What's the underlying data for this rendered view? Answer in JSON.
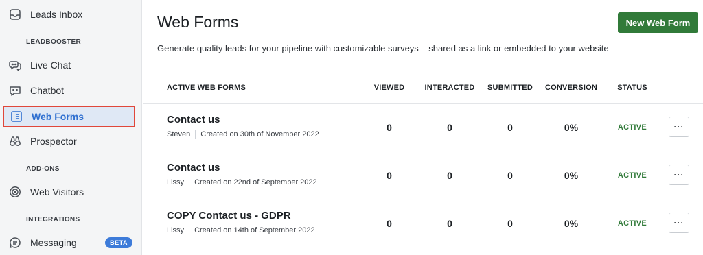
{
  "sidebar": {
    "items": [
      {
        "label": "Leads Inbox",
        "icon": "inbox-icon"
      },
      {
        "label": "Live Chat",
        "icon": "chat-bubbles-icon"
      },
      {
        "label": "Chatbot",
        "icon": "bot-icon"
      },
      {
        "label": "Web Forms",
        "icon": "list-form-icon"
      },
      {
        "label": "Prospector",
        "icon": "binoculars-icon"
      },
      {
        "label": "Web Visitors",
        "icon": "radar-icon"
      },
      {
        "label": "Messaging",
        "icon": "message-icon",
        "badge": "BETA"
      }
    ],
    "sections": {
      "leadbooster": "LEADBOOSTER",
      "addons": "ADD-ONS",
      "integrations": "INTEGRATIONS"
    },
    "active_item": "Web Forms"
  },
  "header": {
    "title": "Web Forms",
    "new_button": "New Web Form",
    "subtitle": "Generate quality leads for your pipeline with customizable surveys – shared as a link or embedded to your website"
  },
  "table": {
    "columns": [
      "ACTIVE WEB FORMS",
      "VIEWED",
      "INTERACTED",
      "SUBMITTED",
      "CONVERSION",
      "STATUS"
    ],
    "rows": [
      {
        "name": "Contact us",
        "owner": "Steven",
        "created": "Created on 30th of November 2022",
        "viewed": "0",
        "interacted": "0",
        "submitted": "0",
        "conversion": "0%",
        "status": "ACTIVE",
        "more": "···"
      },
      {
        "name": "Contact us",
        "owner": "Lissy",
        "created": "Created on 22nd of September 2022",
        "viewed": "0",
        "interacted": "0",
        "submitted": "0",
        "conversion": "0%",
        "status": "ACTIVE",
        "more": "···"
      },
      {
        "name": "COPY Contact us - GDPR",
        "owner": "Lissy",
        "created": "Created on 14th of September 2022",
        "viewed": "0",
        "interacted": "0",
        "submitted": "0",
        "conversion": "0%",
        "status": "ACTIVE",
        "more": "···"
      }
    ]
  },
  "colors": {
    "primary_green": "#317a39",
    "active_blue": "#2f6fd0",
    "highlight_red": "#e0473a",
    "badge_blue": "#3d7bd9"
  }
}
